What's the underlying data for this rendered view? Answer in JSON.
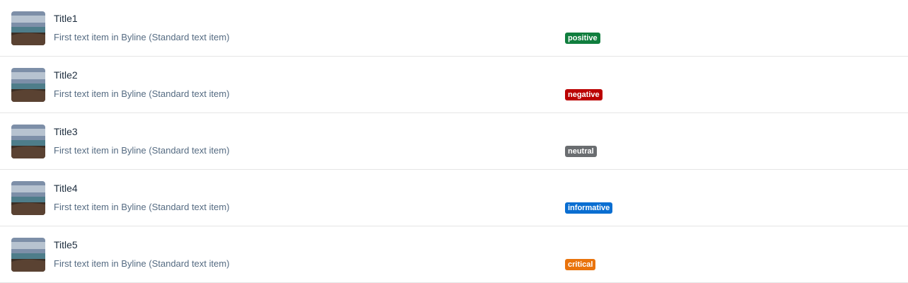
{
  "list": {
    "items": [
      {
        "title": "Title1",
        "byline": "First text item in Byline (Standard text item)",
        "badge": "positive",
        "badge_color": "#107e3e",
        "thumbnail": "landscape-image"
      },
      {
        "title": "Title2",
        "byline": "First text item in Byline (Standard text item)",
        "badge": "negative",
        "badge_color": "#bb0000",
        "thumbnail": "landscape-image"
      },
      {
        "title": "Title3",
        "byline": "First text item in Byline (Standard text item)",
        "badge": "neutral",
        "badge_color": "#6a6d70",
        "thumbnail": "landscape-image"
      },
      {
        "title": "Title4",
        "byline": "First text item in Byline (Standard text item)",
        "badge": "informative",
        "badge_color": "#0a6ed1",
        "thumbnail": "landscape-image"
      },
      {
        "title": "Title5",
        "byline": "First text item in Byline (Standard text item)",
        "badge": "critical",
        "badge_color": "#e9730c",
        "thumbnail": "landscape-image"
      }
    ]
  }
}
